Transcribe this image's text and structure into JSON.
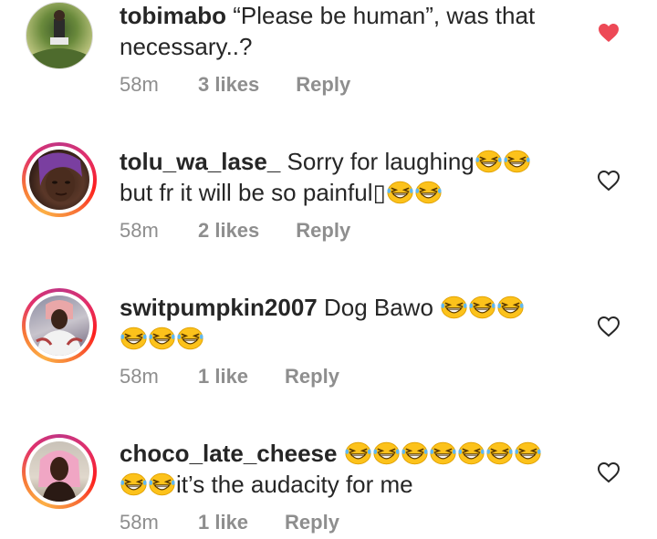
{
  "comments": [
    {
      "username": "tobimabo",
      "text_line1": " “Please be human”, was that",
      "text_line2": "necessary..?",
      "time": "58m",
      "likes": "3 likes",
      "reply": "Reply",
      "liked": true,
      "story_ring": false
    },
    {
      "username": "tolu_wa_lase_",
      "text_line1": " Sorry for laughing",
      "text_line2": "but fr it will be so painful",
      "text_line2_glyph": "▯",
      "emojis_line1": 2,
      "emojis_line2": 2,
      "time": "58m",
      "likes": "2 likes",
      "reply": "Reply",
      "liked": false,
      "story_ring": true
    },
    {
      "username": "switpumpkin2007",
      "text_line1": " Dog Bawo ",
      "emojis_line1": 3,
      "emojis_line2": 3,
      "time": "58m",
      "likes": "1 like",
      "reply": "Reply",
      "liked": false,
      "story_ring": true
    },
    {
      "username": "choco_late_cheese",
      "emojis_line1": 7,
      "text_line2": "it’s the audacity for me",
      "emojis_line2": 2,
      "time": "58m",
      "likes": "1 like",
      "reply": "Reply",
      "liked": false,
      "story_ring": true
    }
  ],
  "icons": {
    "liked_heart": "heart-filled-icon",
    "unliked_heart": "heart-outline-icon",
    "emoji": "grinning-squinting-face-emoji"
  },
  "colors": {
    "liked_heart": "#ed4956",
    "meta_text": "#8e8e8e",
    "main_text": "#262626",
    "emoji_face": "#fcc21b"
  }
}
